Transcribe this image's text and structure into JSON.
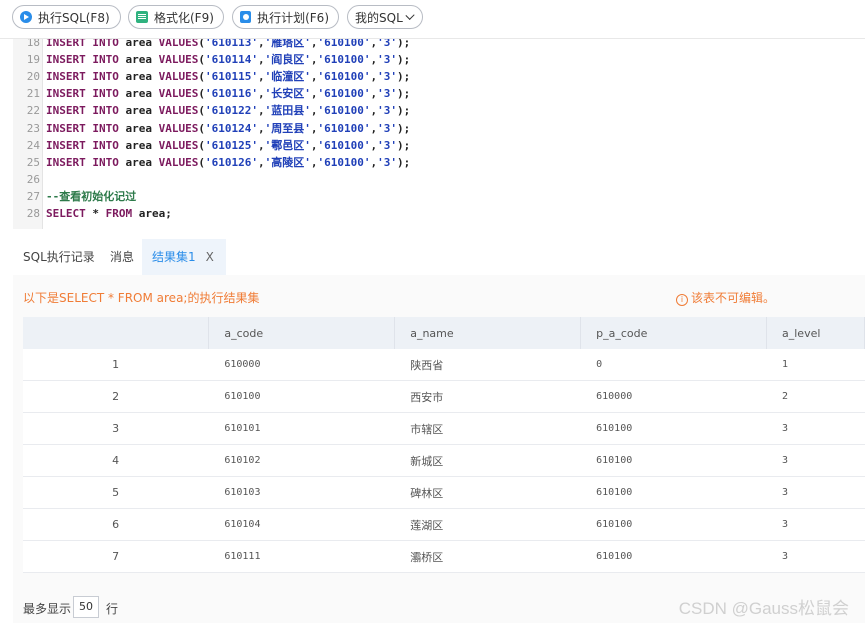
{
  "toolbar": {
    "run_label": "执行SQL(F8)",
    "format_label": "格式化(F9)",
    "plan_label": "执行计划(F6)",
    "mysql_label": "我的SQL"
  },
  "editor": {
    "lines": [
      {
        "n": "18",
        "code": "INSERT INTO area VALUES('610113','雁塔区','610100','3');"
      },
      {
        "n": "19",
        "code": "INSERT INTO area VALUES('610114','阎良区','610100','3');"
      },
      {
        "n": "20",
        "code": "INSERT INTO area VALUES('610115','临潼区','610100','3');"
      },
      {
        "n": "21",
        "code": "INSERT INTO area VALUES('610116','长安区','610100','3');"
      },
      {
        "n": "22",
        "code": "INSERT INTO area VALUES('610122','蓝田县','610100','3');"
      },
      {
        "n": "23",
        "code": "INSERT INTO area VALUES('610124','周至县','610100','3');"
      },
      {
        "n": "24",
        "code": "INSERT INTO area VALUES('610125','鄠邑区','610100','3');"
      },
      {
        "n": "25",
        "code": "INSERT INTO area VALUES('610126','高陵区','610100','3');"
      },
      {
        "n": "26",
        "code": ""
      },
      {
        "n": "27",
        "code": "--查看初始化记过"
      },
      {
        "n": "28",
        "code": "SELECT * FROM area;"
      }
    ]
  },
  "tabs": {
    "history": "SQL执行记录",
    "messages": "消息",
    "result1": "结果集1",
    "close": "X"
  },
  "result": {
    "info": "以下是SELECT * FROM area;的执行结果集",
    "warning": "该表不可编辑。",
    "columns": [
      "",
      "a_code",
      "a_name",
      "p_a_code",
      "a_level"
    ],
    "rows": [
      [
        "1",
        "610000",
        "陕西省",
        "0",
        "1"
      ],
      [
        "2",
        "610100",
        "西安市",
        "610000",
        "2"
      ],
      [
        "3",
        "610101",
        "市辖区",
        "610100",
        "3"
      ],
      [
        "4",
        "610102",
        "新城区",
        "610100",
        "3"
      ],
      [
        "5",
        "610103",
        "碑林区",
        "610100",
        "3"
      ],
      [
        "6",
        "610104",
        "莲湖区",
        "610100",
        "3"
      ],
      [
        "7",
        "610111",
        "灞桥区",
        "610100",
        "3"
      ]
    ]
  },
  "footer": {
    "max_label": "最多显示",
    "max_value": "50",
    "unit": "行"
  },
  "watermark": "CSDN @Gauss松鼠会"
}
